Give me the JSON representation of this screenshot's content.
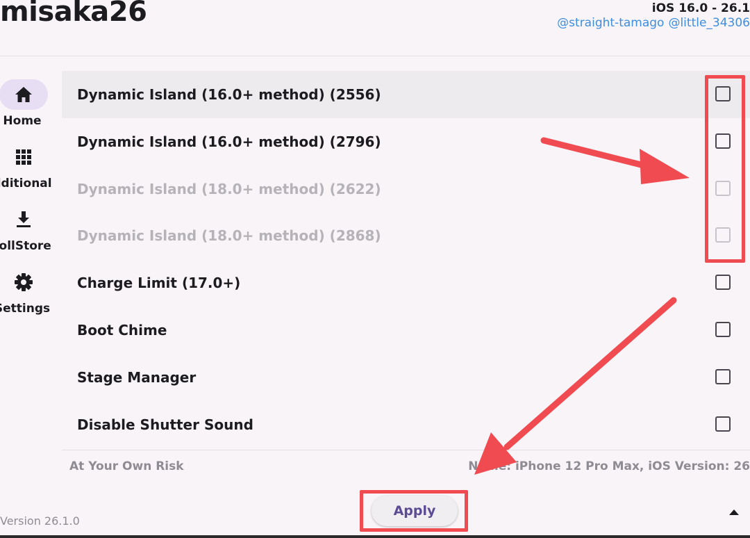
{
  "header": {
    "app_title": "misaka26",
    "ios_range": "iOS 16.0 - 26.1",
    "credits": [
      "@straight-tamago",
      "@little_34306"
    ]
  },
  "sidebar": {
    "items": [
      {
        "label": "Home",
        "icon": "home-icon",
        "active": true
      },
      {
        "label": "dditional",
        "icon": "grid-icon",
        "active": false
      },
      {
        "label": "rollStore",
        "icon": "download-icon",
        "active": false
      },
      {
        "label": "Settings",
        "icon": "gear-icon",
        "active": false
      }
    ]
  },
  "tweaks": [
    {
      "label": "Dynamic Island (16.0+ method) (2556)",
      "checked": false,
      "enabled": true
    },
    {
      "label": "Dynamic Island (16.0+ method) (2796)",
      "checked": false,
      "enabled": true
    },
    {
      "label": "Dynamic Island (18.0+ method) (2622)",
      "checked": false,
      "enabled": false
    },
    {
      "label": "Dynamic Island (18.0+ method) (2868)",
      "checked": false,
      "enabled": false
    },
    {
      "label": "Charge Limit (17.0+)",
      "checked": false,
      "enabled": true
    },
    {
      "label": "Boot Chime",
      "checked": false,
      "enabled": true
    },
    {
      "label": "Stage Manager",
      "checked": false,
      "enabled": true
    },
    {
      "label": "Disable Shutter Sound",
      "checked": false,
      "enabled": true
    }
  ],
  "footer": {
    "risk_note": "At Your Own Risk",
    "device_info": "Name: iPhone 12 Pro Max,  iOS Version: 26",
    "version": "Version 26.1.0",
    "apply_label": "Apply"
  },
  "colors": {
    "annotation_red": "#f04b50",
    "accent_purple": "#5a4b93",
    "link_blue": "#3d8ee0"
  }
}
